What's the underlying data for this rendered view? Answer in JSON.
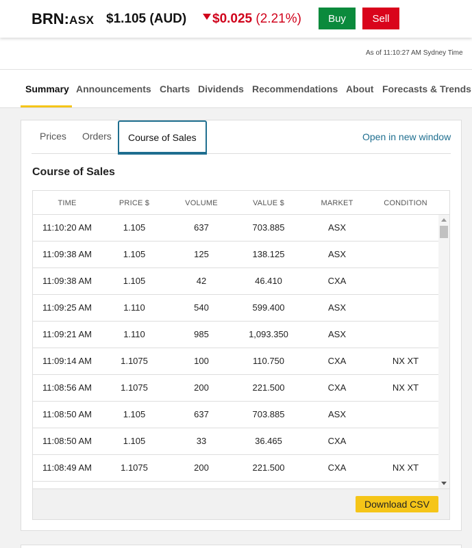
{
  "quote": {
    "ticker": "BRN:",
    "exchange": "ASX",
    "price": "$1.105 (AUD)",
    "change_amount": "$0.025",
    "change_percent": "(2.21%)",
    "buy_label": "Buy",
    "sell_label": "Sell",
    "as_of": "As of 11:10:27 AM Sydney Time"
  },
  "nav": {
    "items": [
      "Summary",
      "Announcements",
      "Charts",
      "Dividends",
      "Recommendations",
      "About",
      "Forecasts & Trends"
    ],
    "active": "Summary"
  },
  "subtabs": {
    "items": [
      "Prices",
      "Orders",
      "Course of Sales"
    ],
    "active": "Course of Sales",
    "open_new_window": "Open in new window"
  },
  "section_title": "Course of Sales",
  "table": {
    "headers": [
      "TIME",
      "PRICE $",
      "VOLUME",
      "VALUE $",
      "MARKET",
      "CONDITION"
    ],
    "rows": [
      [
        "11:10:20 AM",
        "1.105",
        "637",
        "703.885",
        "ASX",
        ""
      ],
      [
        "11:09:38 AM",
        "1.105",
        "125",
        "138.125",
        "ASX",
        ""
      ],
      [
        "11:09:38 AM",
        "1.105",
        "42",
        "46.410",
        "CXA",
        ""
      ],
      [
        "11:09:25 AM",
        "1.110",
        "540",
        "599.400",
        "ASX",
        ""
      ],
      [
        "11:09:21 AM",
        "1.110",
        "985",
        "1,093.350",
        "ASX",
        ""
      ],
      [
        "11:09:14 AM",
        "1.1075",
        "100",
        "110.750",
        "CXA",
        "NX XT"
      ],
      [
        "11:08:56 AM",
        "1.1075",
        "200",
        "221.500",
        "CXA",
        "NX XT"
      ],
      [
        "11:08:50 AM",
        "1.105",
        "637",
        "703.885",
        "ASX",
        ""
      ],
      [
        "11:08:50 AM",
        "1.105",
        "33",
        "36.465",
        "CXA",
        ""
      ],
      [
        "11:08:49 AM",
        "1.1075",
        "200",
        "221.500",
        "CXA",
        "NX XT"
      ],
      [
        "",
        "",
        "",
        "",
        "",
        ""
      ]
    ],
    "download_label": "Download CSV"
  },
  "colors": {
    "buy": "#0b8a3c",
    "sell": "#d9041b",
    "negative": "#d0021b",
    "accent_yellow": "#f5c518",
    "link": "#1e6e8f"
  }
}
